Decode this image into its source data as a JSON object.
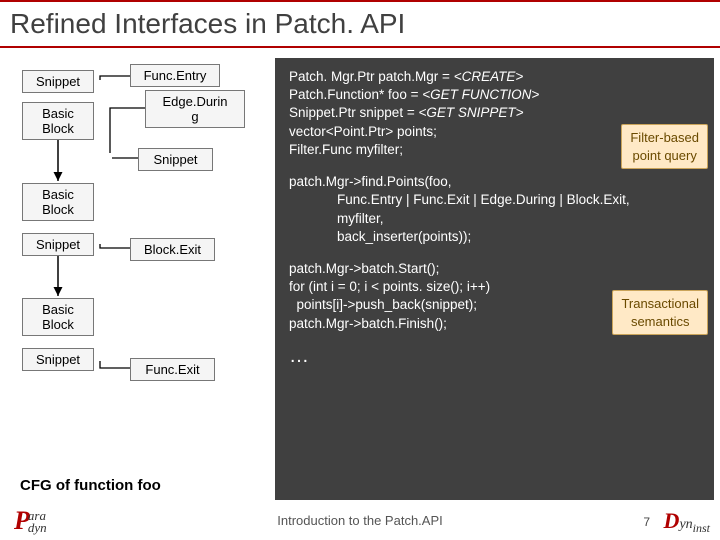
{
  "title": "Refined Interfaces in Patch. API",
  "diagram": {
    "snippet": "Snippet",
    "basic_block": "Basic\nBlock",
    "func_entry": "Func.Entry",
    "edge_during": "Edge.Durin\ng",
    "snippet_evt": "Snippet",
    "block_exit": "Block.Exit",
    "func_exit": "Func.Exit",
    "caption": "CFG of function foo"
  },
  "code": {
    "l1a": "Patch. Mgr.Ptr patch.Mgr = ",
    "l1b": "<CREATE>",
    "l2a": "Patch.Function* foo = ",
    "l2b": "<GET FUNCTION>",
    "l3a": "Snippet.Ptr snippet = ",
    "l3b": "<GET SNIPPET>",
    "l4": "vector<Point.Ptr> points;",
    "l5": "Filter.Func myfilter;",
    "l7": "patch.Mgr->find.Points(foo,",
    "l8": "Func.Entry | Func.Exit | Edge.During | Block.Exit,",
    "l9": "myfilter,",
    "l10": "back_inserter(points));",
    "l12": "patch.Mgr->batch.Start();",
    "l13": "for (int i = 0; i < points. size(); i++)",
    "l14": "  points[i]->push_back(snippet);",
    "l15": "patch.Mgr->batch.Finish();",
    "ellipsis": "…"
  },
  "callouts": {
    "filter": "Filter-based\npoint query",
    "txn": "Transactional\nsemantics"
  },
  "footer": {
    "text": "Introduction to the Patch.API",
    "page": "7"
  },
  "logos": {
    "left_p": "P",
    "left_rest": "ara\ndyn",
    "right_d": "D",
    "right_yn": "yn",
    "right_inst": "inst"
  }
}
